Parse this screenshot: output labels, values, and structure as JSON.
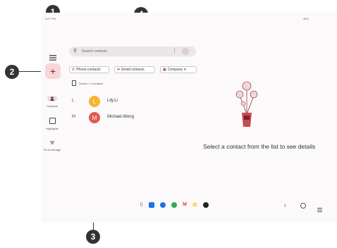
{
  "callouts": [
    "1",
    "2",
    "3",
    "4"
  ],
  "status_bar": {
    "time": "5:07 PM",
    "right": "48%"
  },
  "search": {
    "placeholder": "Search contacts"
  },
  "filter_chips": [
    {
      "label": "Phone contacts"
    },
    {
      "label": "Email contacts"
    },
    {
      "label": "Company",
      "chevron": "▾"
    }
  ],
  "device_label": "Device • 2 contacts",
  "contacts": [
    {
      "section": "L",
      "initial": "L",
      "name": "Lily.Li",
      "color": "#f2b72c"
    },
    {
      "section": "M",
      "initial": "M",
      "name": "Michael.Wong",
      "color": "#e05a50"
    }
  ],
  "nav_rail": [
    {
      "label": "Contacts",
      "icon": "person-icon"
    },
    {
      "label": "Highlights",
      "icon": "highlights-icon"
    },
    {
      "label": "Fix & manage",
      "icon": "wrench-icon"
    }
  ],
  "empty_state": {
    "text": "Select a contact from the list to see details"
  },
  "taskbar": {
    "apps": [
      {
        "icon": "app-drawer-icon",
        "color": "#555555"
      },
      {
        "icon": "camera-icon",
        "color": "#1a73e8"
      },
      {
        "icon": "messages-icon",
        "color": "#1a73e8"
      },
      {
        "icon": "chrome-icon",
        "color": "#34a853"
      },
      {
        "icon": "gmail-icon",
        "color": "#ea4335"
      },
      {
        "icon": "photos-icon",
        "color": "#fbbc04"
      },
      {
        "icon": "camera-app-icon",
        "color": "#202124"
      }
    ]
  },
  "colors": {
    "fab": "#f7d7d9",
    "accent": "#8a1c2b"
  }
}
